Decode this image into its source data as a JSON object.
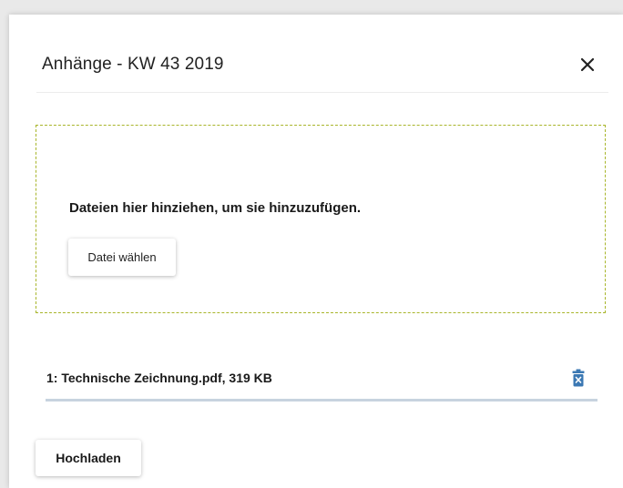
{
  "dialog": {
    "title": "Anhänge - KW 43 2019",
    "close_icon": "close-icon"
  },
  "dropzone": {
    "hint": "Dateien hier hinziehen, um sie hinzuzufügen.",
    "choose_label": "Datei wählen"
  },
  "files": [
    {
      "label": "1: Technische Zeichnung.pdf, 319 KB",
      "delete_icon": "trash-icon"
    }
  ],
  "actions": {
    "upload_label": "Hochladen"
  },
  "colors": {
    "dropzone_border": "#a8b52a",
    "delete_icon": "#3b78b3",
    "row_underline": "#c7d3df"
  }
}
